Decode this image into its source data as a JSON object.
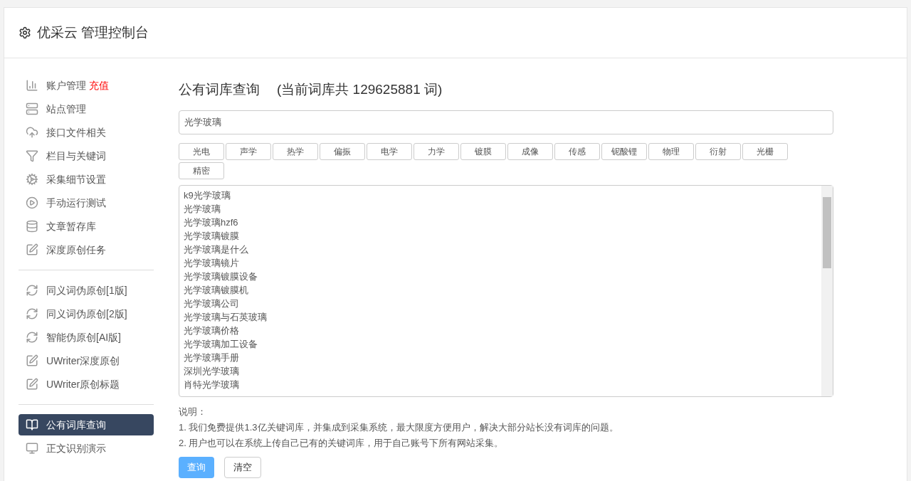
{
  "header": {
    "title": "优采云 管理控制台"
  },
  "sidebar": {
    "groups": [
      {
        "items": [
          {
            "label": "账户管理",
            "badge": "充值",
            "selected": false
          },
          {
            "label": "站点管理",
            "selected": false
          },
          {
            "label": "接口文件相关",
            "selected": false
          },
          {
            "label": "栏目与关键词",
            "selected": false
          },
          {
            "label": "采集细节设置",
            "selected": false
          },
          {
            "label": "手动运行测试",
            "selected": false
          },
          {
            "label": "文章暂存库",
            "selected": false
          },
          {
            "label": "深度原创任务",
            "selected": false
          }
        ]
      },
      {
        "items": [
          {
            "label": "同义词伪原创[1版]",
            "selected": false
          },
          {
            "label": "同义词伪原创[2版]",
            "selected": false
          },
          {
            "label": "智能伪原创[AI版]",
            "selected": false
          },
          {
            "label": "UWriter深度原创",
            "selected": false
          },
          {
            "label": "UWriter原创标题",
            "selected": false
          }
        ]
      },
      {
        "items": [
          {
            "label": "公有词库查询",
            "selected": true
          },
          {
            "label": "正文识别演示",
            "selected": false
          }
        ]
      }
    ]
  },
  "main": {
    "title": "公有词库查询",
    "subtitle": "(当前词库共 129625881 词)",
    "search": {
      "value": "光学玻璃"
    },
    "tags": [
      "光电",
      "声学",
      "热学",
      "偏振",
      "电学",
      "力学",
      "镀膜",
      "成像",
      "传感",
      "铌酸锂",
      "物理",
      "衍射",
      "光栅",
      "精密"
    ],
    "results": [
      "k9光学玻璃",
      "光学玻璃",
      "光学玻璃hzf6",
      "光学玻璃镀膜",
      "光学玻璃是什么",
      "光学玻璃镜片",
      "光学玻璃镀膜设备",
      "光学玻璃镀膜机",
      "光学玻璃公司",
      "光学玻璃与石英玻璃",
      "光学玻璃价格",
      "光学玻璃加工设备",
      "光学玻璃手册",
      "深圳光学玻璃",
      "肖特光学玻璃"
    ],
    "notes": [
      "说明：",
      "1. 我们免费提供1.3亿关键词库，并集成到采集系统，最大限度方便用户，解决大部分站长没有词库的问题。",
      "2. 用户也可以在系统上传自己已有的关键词库，用于自己账号下所有网站采集。"
    ],
    "buttons": [
      {
        "label": "查询",
        "kind": "primary"
      },
      {
        "label": "清空",
        "kind": "default"
      }
    ]
  }
}
